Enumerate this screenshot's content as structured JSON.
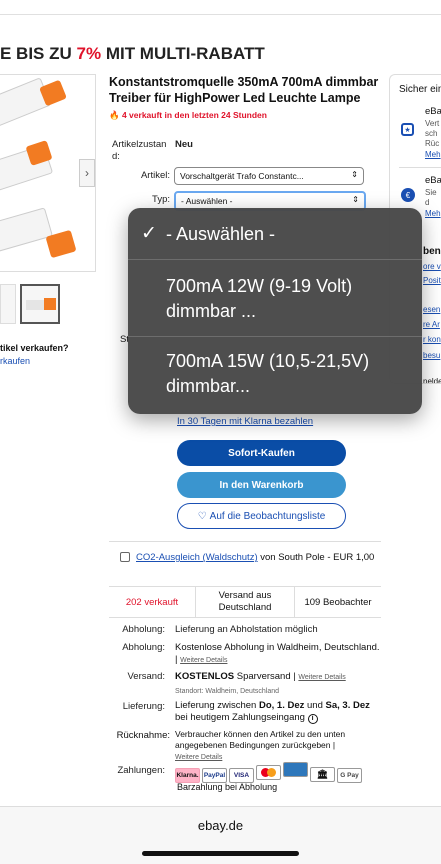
{
  "banner": {
    "prefix": "E BIS ZU ",
    "percent": "7%",
    "suffix": " MIT MULTI-RABATT"
  },
  "title": "Konstantstromquelle 350mA 700mA dimmbar Treiber für HighPower Led Leuchte Lampe",
  "sold_notice": "4 verkauft in den letzten 24 Stunden",
  "condition": {
    "label": "Artikelzustand:",
    "value": "Neu"
  },
  "article": {
    "label": "Artikel:",
    "value": "Vorschaltgerät Trafo Constantc..."
  },
  "type": {
    "label": "Typ:",
    "value": "- Auswählen -"
  },
  "dropdown": {
    "options": [
      {
        "label": "- Auswählen -",
        "checkmark": "✓"
      },
      {
        "label": "700mA 12W (9-19 Volt) dimmbar ..."
      },
      {
        "label": "700mA 15W (10,5-21,5V) dimmbar..."
      }
    ]
  },
  "left": {
    "sell_question": "tikel verkaufen?",
    "sell_link": "rkaufen",
    "st": "St"
  },
  "klarna_link": "In 30 Tagen mit Klarna bezahlen",
  "buttons": {
    "buy_now": "Sofort-Kaufen",
    "cart": "In den Warenkorb",
    "watch": "Auf die Beobachtungsliste"
  },
  "co2": {
    "link": "CO2-Ausgleich (Waldschutz)",
    "rest": " von South Pole - EUR 1,00"
  },
  "stats": {
    "sold": "202 verkauft",
    "shipping_from": "Versand aus Deutschland",
    "watchers": "109 Beobachter"
  },
  "details": {
    "pickup1": {
      "label": "Abholung:",
      "value": "Lieferung an Abholstation möglich"
    },
    "pickup2": {
      "label": "Abholung:",
      "value": "Kostenlose Abholung in Waldheim, Deutschland.",
      "more": "Weitere Details"
    },
    "shipping": {
      "label": "Versand:",
      "free": "KOSTENLOS",
      "method": " Sparversand | ",
      "more": "Weitere Details",
      "location": "Standort: Waldheim, Deutschland"
    },
    "delivery": {
      "label": "Lieferung:",
      "text": "Lieferung zwischen ",
      "d1": "Do, 1. Dez",
      "and": " und ",
      "d2": "Sa, 3. Dez",
      "tail": " bei heutigem Zahlungseingang"
    },
    "returns": {
      "label": "Rücknahme:",
      "text": "Verbraucher können den Artikel zu den unten angegebenen Bedingungen zurückgeben |",
      "more": "Weitere Details"
    },
    "payments": {
      "label": "Zahlungen:",
      "methods": [
        "Klarna.",
        "PayPal",
        "VISA",
        "",
        "",
        "",
        "G Pay"
      ],
      "cash": "Barzahlung bei Abholung"
    }
  },
  "right": {
    "secure": "Sicher ein",
    "ebay1": "eBa",
    "ebay1_lines": [
      "Vert",
      "sch",
      "Rüc"
    ],
    "ebay1_more": "Meh",
    "ebay2": "eBa",
    "ebay2_lines": [
      "Sie",
      "d"
    ],
    "ebay2_more": "Meh",
    "bold": "ben",
    "l1": "ore v",
    "l2": "Posit",
    "l3": "esen",
    "l4": "re Ar",
    "l5": "r kon",
    "l6": "besu",
    "nelde": "nelde"
  },
  "bottom": {
    "url": "ebay.de"
  },
  "colors": {
    "accent_red": "#e0132b",
    "link_blue": "#1a4fb3",
    "buy_blue": "#0a4da6",
    "cart_blue": "#3a95cf"
  }
}
